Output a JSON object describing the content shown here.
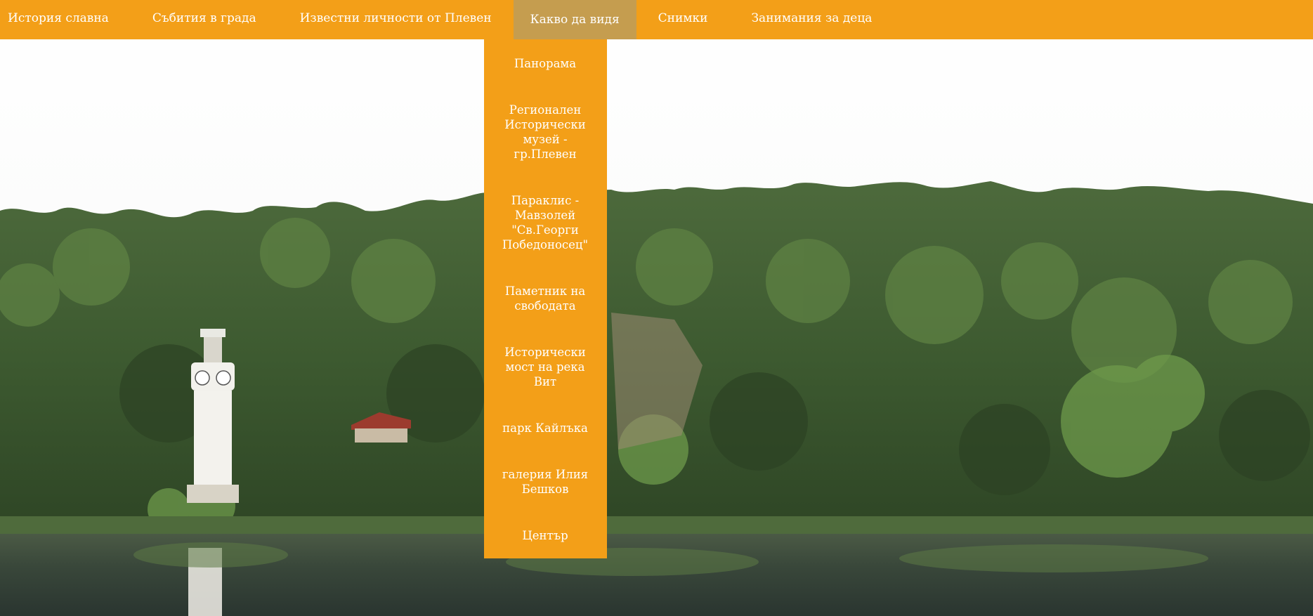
{
  "colors": {
    "nav_bg": "#f39f18",
    "nav_active_bg": "#c59d4f",
    "nav_text": "#ffffff"
  },
  "nav": {
    "items": [
      {
        "label": "История славна"
      },
      {
        "label": "Събития в града"
      },
      {
        "label": "Известни личности от Плевен"
      },
      {
        "label": "Какво да видя"
      },
      {
        "label": "Снимки"
      },
      {
        "label": "Занимания за деца"
      }
    ],
    "active_index": 3
  },
  "dropdown": {
    "items": [
      {
        "label": "Панорама"
      },
      {
        "label": "Регионален Исторически музей - гр.Плевен"
      },
      {
        "label": "Параклис - Мавзолей \"Св.Георги Победоносец\""
      },
      {
        "label": "Паметник на свободата"
      },
      {
        "label": "Исторически мост на река Вит"
      },
      {
        "label": "парк Кайлъка"
      },
      {
        "label": "галерия Илия Бешков"
      },
      {
        "label": "Център"
      }
    ]
  },
  "hero": {
    "icon": "landscape-photo-lake-forest-lighthouse"
  }
}
